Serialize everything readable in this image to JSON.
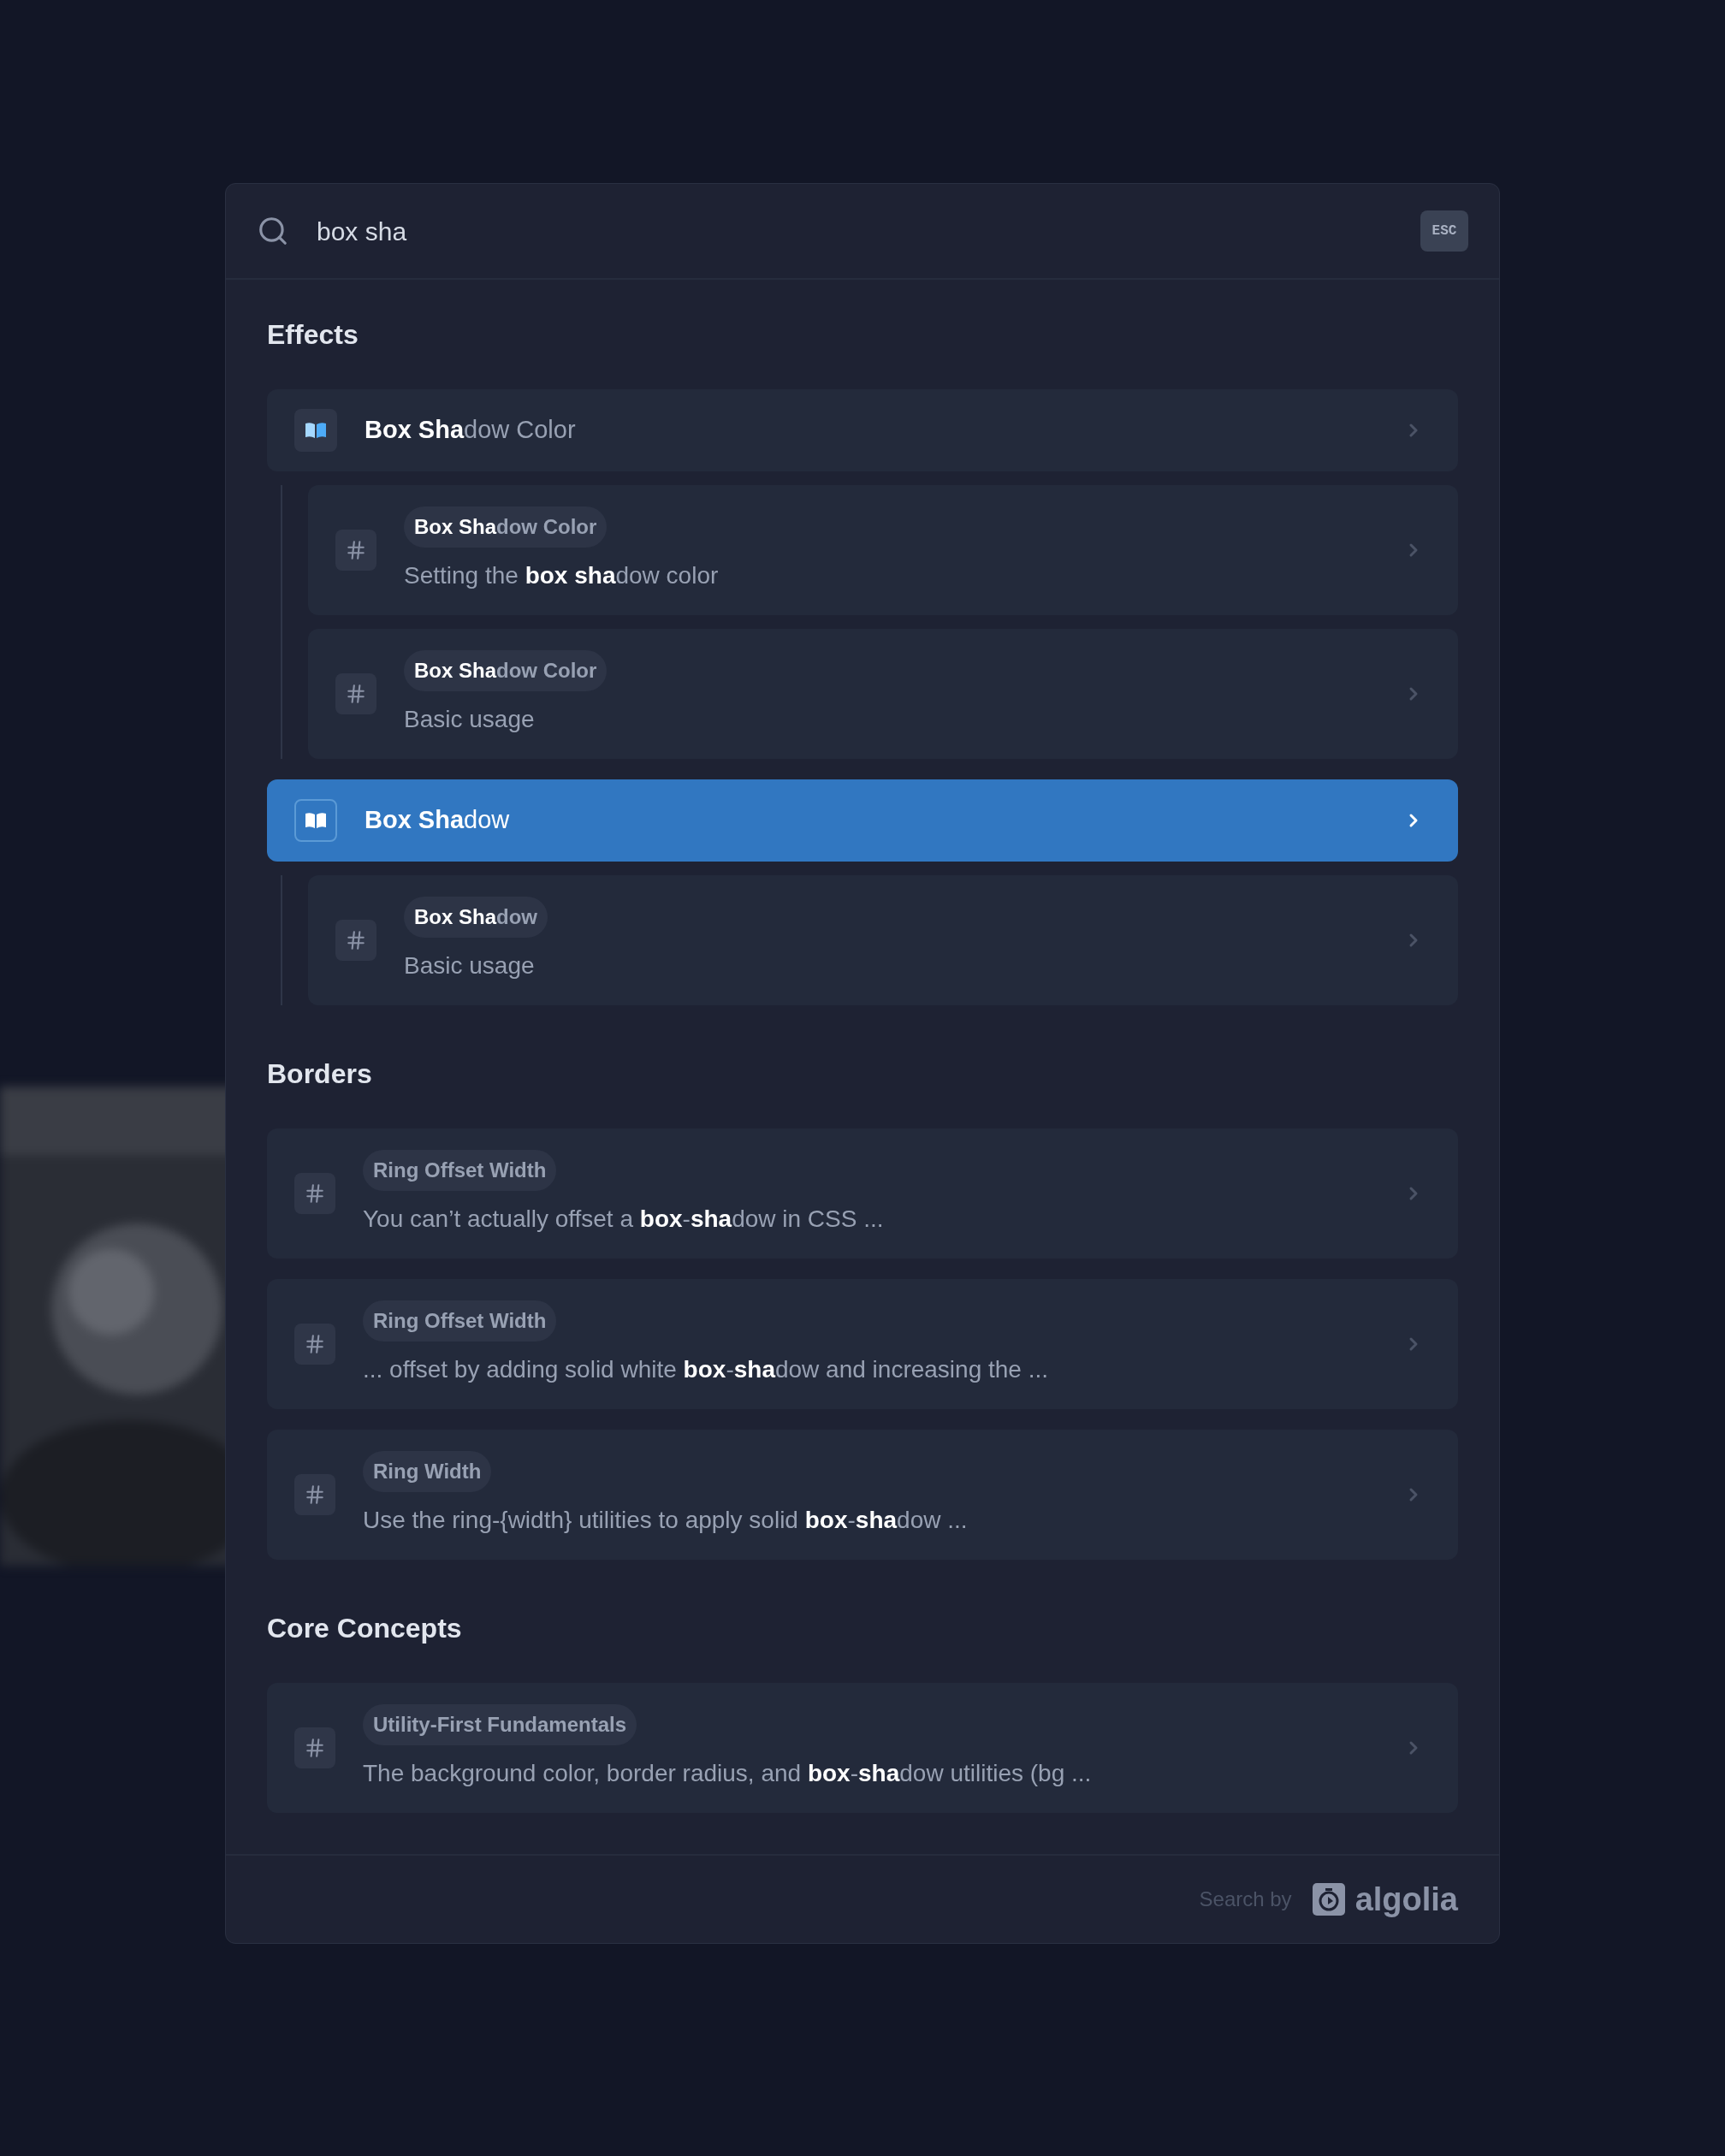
{
  "search": {
    "value": "box sha",
    "esc_key": "ESC"
  },
  "groups": [
    {
      "title": "Effects",
      "results": [
        {
          "kind": "page",
          "title": "**Box Sha**dow Color",
          "selected": false,
          "children": [
            {
              "kind": "section",
              "pill": "**Box Sha**dow Color",
              "text": "Setting the **box sha**dow color",
              "selected": false
            },
            {
              "kind": "section",
              "pill": "**Box Sha**dow Color",
              "text": "Basic usage",
              "selected": false
            }
          ]
        },
        {
          "kind": "page",
          "title": "**Box Sha**dow",
          "selected": true,
          "children": [
            {
              "kind": "section",
              "pill": "**Box Sha**dow",
              "text": "Basic usage",
              "selected": false
            }
          ]
        }
      ]
    },
    {
      "title": "Borders",
      "results": [
        {
          "kind": "section",
          "pill": "Ring Offset Width",
          "text": "You can’t actually offset a **box**-**sha**dow in CSS ...",
          "selected": false
        },
        {
          "kind": "section",
          "pill": "Ring Offset Width",
          "text": "... offset by adding solid white **box**-**sha**dow and increasing the ...",
          "selected": false
        },
        {
          "kind": "section",
          "pill": "Ring Width",
          "text": "Use the ring-{width} utilities to apply solid **box**-**sha**dow ...",
          "selected": false
        }
      ]
    },
    {
      "title": "Core Concepts",
      "results": [
        {
          "kind": "section",
          "pill": "Utility-First Fundamentals",
          "text": "The background color, border radius, and **box**-**sha**dow utilities (bg ...",
          "selected": false
        }
      ]
    }
  ],
  "footer": {
    "label": "Search by",
    "logo_text": "algolia"
  }
}
